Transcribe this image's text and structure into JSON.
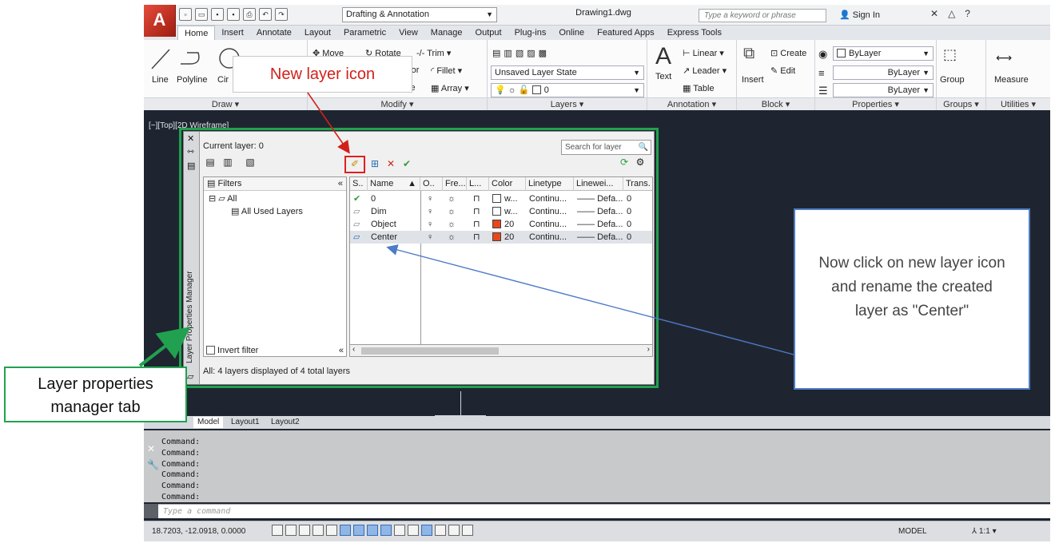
{
  "titlebar": {
    "logo": "A",
    "workspace": "Drafting & Annotation",
    "document": "Drawing1.dwg",
    "search_placeholder": "Type a keyword or phrase",
    "signin": "Sign In"
  },
  "ribbon_tabs": [
    "Home",
    "Insert",
    "Annotate",
    "Layout",
    "Parametric",
    "View",
    "Manage",
    "Output",
    "Plug-ins",
    "Online",
    "Featured Apps",
    "Express Tools"
  ],
  "ribbon": {
    "draw": {
      "title": "Draw",
      "line": "Line",
      "polyline": "Polyline",
      "circle": "Cir"
    },
    "modify": {
      "title": "Modify",
      "move": "Move",
      "rotate": "Rotate",
      "trim": "Trim",
      "mirror": "ror",
      "fillet": "Fillet",
      "scale": "le",
      "array": "Array"
    },
    "layers": {
      "title": "Layers",
      "state": "Unsaved Layer State",
      "layer_value": "0"
    },
    "annotation": {
      "title": "Annotation",
      "text": "Text",
      "linear": "Linear",
      "leader": "Leader",
      "table": "Table"
    },
    "block": {
      "title": "Block",
      "insert": "Insert",
      "create": "Create",
      "edit": "Edit"
    },
    "properties": {
      "title": "Properties",
      "color": "ByLayer",
      "linetype": "ByLayer",
      "lineweight": "ByLayer"
    },
    "groups": {
      "title": "Groups",
      "group": "Group"
    },
    "utilities": {
      "title": "Utilities",
      "measure": "Measure"
    }
  },
  "viewport_label": "[−][Top][2D Wireframe]",
  "layer_manager": {
    "side_title": "Layer Properties Manager",
    "current_layer": "Current layer: 0",
    "search_placeholder": "Search for layer",
    "filters_header": "Filters",
    "tree": [
      {
        "label": "All"
      },
      {
        "label": "All Used Layers"
      }
    ],
    "invert_filter": "Invert filter",
    "columns": [
      "S..",
      "Name",
      "O..",
      "Fre...",
      "L...",
      "Color",
      "Linetype",
      "Linewei...",
      "Trans."
    ],
    "rows": [
      {
        "status": "current",
        "name": "0",
        "color_label": "w...",
        "color_hex": "#ffffff",
        "linetype": "Continu...",
        "lineweight": "Defa...",
        "trans": "0"
      },
      {
        "status": "",
        "name": "Dim",
        "color_label": "w...",
        "color_hex": "#ffffff",
        "linetype": "Continu...",
        "lineweight": "Defa...",
        "trans": "0"
      },
      {
        "status": "",
        "name": "Object",
        "color_label": "20",
        "color_hex": "#e8471c",
        "linetype": "Continu...",
        "lineweight": "Defa...",
        "trans": "0"
      },
      {
        "status": "",
        "name": "Center",
        "color_label": "20",
        "color_hex": "#e8471c",
        "linetype": "Continu...",
        "lineweight": "Defa...",
        "trans": "0"
      }
    ],
    "status_text": "All: 4 layers displayed of 4 total layers"
  },
  "layout_tabs": [
    "Model",
    "Layout1",
    "Layout2"
  ],
  "command_history": [
    "Command:",
    "Command:",
    "Command:",
    "Command:",
    "Command:",
    "Command:"
  ],
  "command_placeholder": "Type a command",
  "statusbar": {
    "coords": "18.7203, -12.0918, 0.0000",
    "model": "MODEL",
    "scale": "1:1"
  },
  "callouts": {
    "new_layer": "New layer icon",
    "instruction": "Now click on new layer icon and rename the created layer as \"Center\"",
    "lpm_tab": "Layer properties manager tab"
  },
  "colors": {
    "callout_red": "#d1211b",
    "callout_blue": "#4d7bc7",
    "callout_green": "#21a150"
  }
}
